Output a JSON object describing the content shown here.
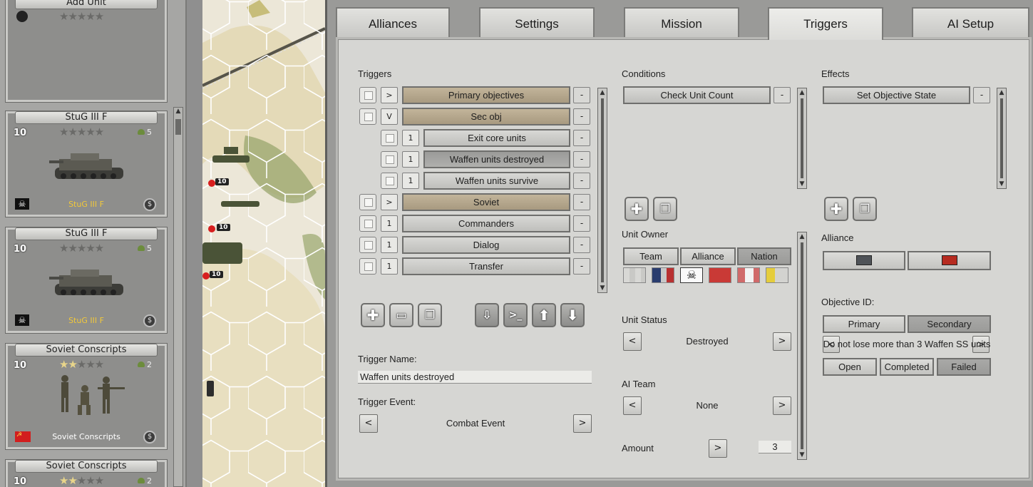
{
  "units": [
    {
      "name": "Add Unit",
      "stars": 0,
      "strength": "",
      "xp": "",
      "label": "",
      "faction": "none"
    },
    {
      "name": "StuG III F",
      "strength": "10",
      "stars": 0,
      "xp": "5",
      "label": "StuG III F",
      "faction": "waffen-ss"
    },
    {
      "name": "StuG III F",
      "strength": "10",
      "stars": 0,
      "xp": "5",
      "label": "StuG III F",
      "faction": "waffen-ss"
    },
    {
      "name": "Soviet Conscripts",
      "strength": "10",
      "stars": 1.5,
      "xp": "2",
      "label": "Soviet Conscripts",
      "faction": "soviet"
    },
    {
      "name": "Soviet Conscripts",
      "strength": "10",
      "stars": 1.5,
      "xp": "2",
      "label": "",
      "faction": "soviet"
    }
  ],
  "map": {
    "unit_strengths": [
      "10",
      "10",
      "10"
    ]
  },
  "tabs": [
    {
      "label": "Alliances",
      "active": false
    },
    {
      "label": "Settings",
      "active": false
    },
    {
      "label": "Mission",
      "active": false
    },
    {
      "label": "Triggers",
      "active": true
    },
    {
      "label": "AI Setup",
      "active": false
    }
  ],
  "triggers": {
    "heading": "Triggers",
    "rows": [
      {
        "toggle": ">",
        "label": "Primary objectives",
        "style": "tan",
        "indent": false
      },
      {
        "toggle": "V",
        "label": "Sec obj",
        "style": "tan",
        "indent": false
      },
      {
        "toggle": "1",
        "label": "Exit core units",
        "style": "plain",
        "indent": true
      },
      {
        "toggle": "1",
        "label": "Waffen units destroyed",
        "style": "selected",
        "indent": true
      },
      {
        "toggle": "1",
        "label": "Waffen units survive",
        "style": "plain",
        "indent": true
      },
      {
        "toggle": ">",
        "label": "Soviet",
        "style": "tan",
        "indent": false
      },
      {
        "toggle": "1",
        "label": "Commanders",
        "style": "plain",
        "indent": false
      },
      {
        "toggle": "1",
        "label": "Dialog",
        "style": "plain",
        "indent": false
      },
      {
        "toggle": "1",
        "label": "Transfer",
        "style": "plain",
        "indent": false
      }
    ],
    "remove_symbol": "-",
    "name_label": "Trigger Name:",
    "name_value": "Waffen units destroyed",
    "event_label": "Trigger Event:",
    "event_value": "Combat Event",
    "prev": "<",
    "next": ">"
  },
  "conditions": {
    "heading": "Conditions",
    "items": [
      "Check Unit Count"
    ],
    "unit_owner_label": "Unit Owner",
    "owner_modes": [
      {
        "label": "Team",
        "active": false
      },
      {
        "label": "Alliance",
        "active": false
      },
      {
        "label": "Nation",
        "active": true
      }
    ],
    "nation_flags": [
      "neutral",
      "german",
      "waffen-ss",
      "soviet",
      "italian",
      "romanian"
    ],
    "unit_status_label": "Unit Status",
    "unit_status_value": "Destroyed",
    "ai_team_label": "AI Team",
    "ai_team_value": "None",
    "amount_label": "Amount",
    "amount_value": "3"
  },
  "effects": {
    "heading": "Effects",
    "items": [
      "Set Objective State"
    ],
    "alliance_label": "Alliance",
    "alliance_colors": [
      "#4f5358",
      "#b62b20"
    ],
    "objective_label": "Objective ID:",
    "objective_types": [
      {
        "label": "Primary",
        "active": false
      },
      {
        "label": "Secondary",
        "active": true
      }
    ],
    "objective_text": "Do not lose more than 3 Waffen SS units",
    "states": [
      {
        "label": "Open",
        "active": false
      },
      {
        "label": "Completed",
        "active": false
      },
      {
        "label": "Failed",
        "active": true
      }
    ]
  },
  "icons": {
    "add": "plus-icon",
    "copy": "copy-icon",
    "folder": "folder-icon",
    "import": "import-icon",
    "console": "console-icon",
    "move_up": "arrow-up-icon",
    "move_down": "arrow-down-icon"
  }
}
